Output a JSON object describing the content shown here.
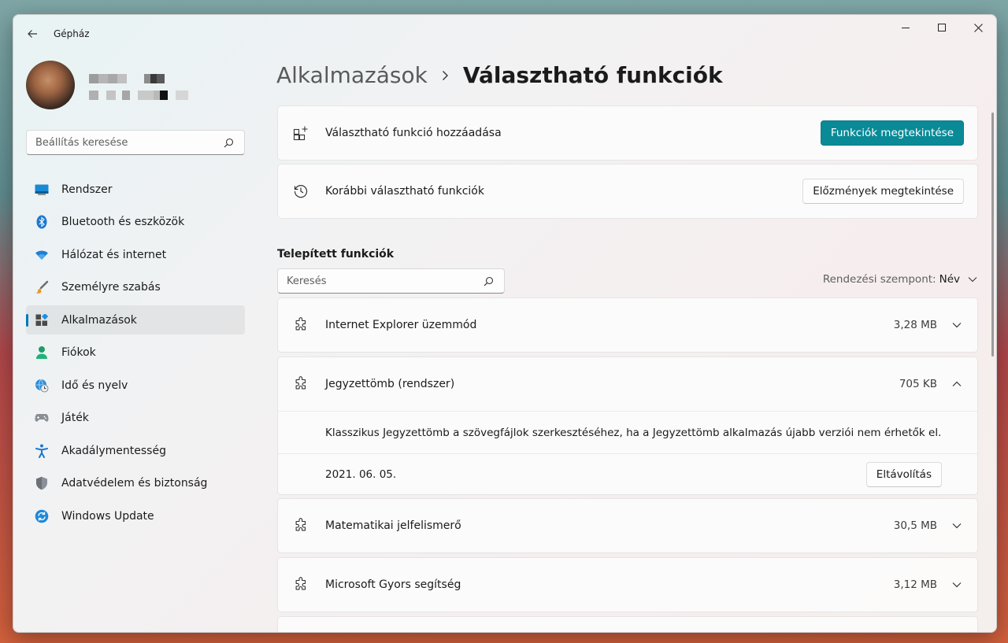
{
  "window": {
    "title": "Gépház"
  },
  "sidebar": {
    "search_placeholder": "Beállítás keresése",
    "items": [
      {
        "label": "Rendszer",
        "icon": "monitor-icon"
      },
      {
        "label": "Bluetooth és eszközök",
        "icon": "bluetooth-icon"
      },
      {
        "label": "Hálózat és internet",
        "icon": "wifi-icon"
      },
      {
        "label": "Személyre szabás",
        "icon": "brush-icon"
      },
      {
        "label": "Alkalmazások",
        "icon": "apps-icon",
        "active": true
      },
      {
        "label": "Fiókok",
        "icon": "person-icon"
      },
      {
        "label": "Idő és nyelv",
        "icon": "globe-clock-icon"
      },
      {
        "label": "Játék",
        "icon": "gamepad-icon"
      },
      {
        "label": "Akadálymentesség",
        "icon": "accessibility-icon"
      },
      {
        "label": "Adatvédelem és biztonság",
        "icon": "shield-icon"
      },
      {
        "label": "Windows Update",
        "icon": "update-icon"
      }
    ]
  },
  "breadcrumb": {
    "parent": "Alkalmazások",
    "current": "Választható funkciók"
  },
  "cards": {
    "add": {
      "label": "Választható funkció hozzáadása",
      "button": "Funkciók megtekintése"
    },
    "history": {
      "label": "Korábbi választható funkciók",
      "button": "Előzmények megtekintése"
    }
  },
  "installed": {
    "title": "Telepített funkciók",
    "search_placeholder": "Keresés",
    "sort_label": "Rendezési szempont:",
    "sort_value": "Név",
    "features": [
      {
        "name": "Internet Explorer üzemmód",
        "size": "3,28 MB",
        "expanded": false
      },
      {
        "name": "Jegyzettömb (rendszer)",
        "size": "705 KB",
        "expanded": true,
        "description": "Klasszikus Jegyzettömb a szövegfájlok szerkesztéséhez, ha a Jegyzettömb alkalmazás újabb verziói nem érhetők el.",
        "date": "2021. 06. 05.",
        "remove_label": "Eltávolítás"
      },
      {
        "name": "Matematikai jelfelismerő",
        "size": "30,5 MB",
        "expanded": false
      },
      {
        "name": "Microsoft Gyors segítség",
        "size": "3,12 MB",
        "expanded": false
      }
    ]
  },
  "colors": {
    "accent": "#0a8a97",
    "nav_indicator": "#0078b4"
  }
}
